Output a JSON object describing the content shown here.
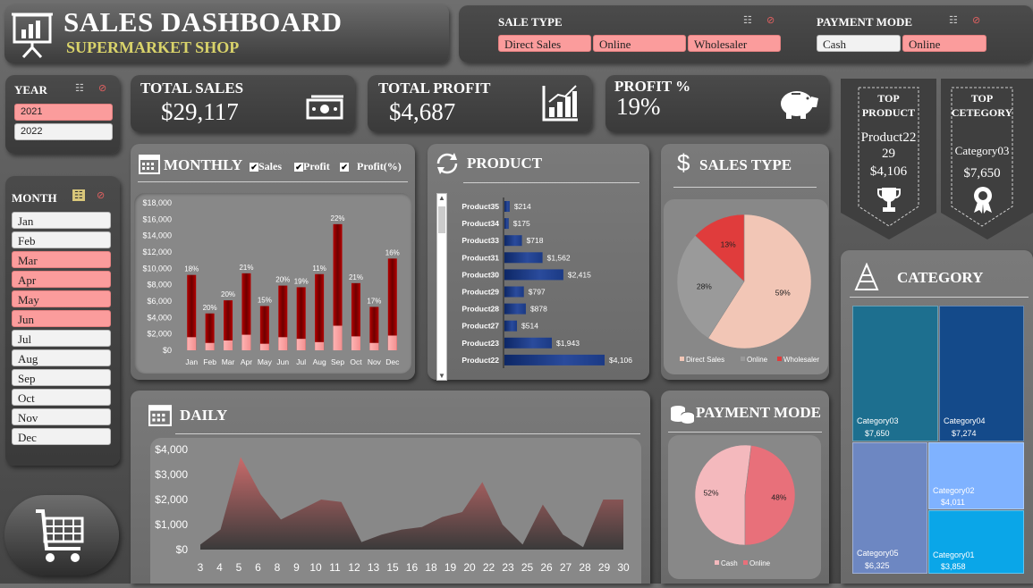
{
  "header": {
    "title": "SALES DASHBOARD",
    "subtitle": "SUPERMARKET SHOP"
  },
  "filters": {
    "sale_type": {
      "label": "SALE TYPE",
      "options": [
        {
          "label": "Direct Sales",
          "selected": true
        },
        {
          "label": "Online",
          "selected": true
        },
        {
          "label": "Wholesaler",
          "selected": true
        }
      ]
    },
    "payment_mode": {
      "label": "PAYMENT MODE",
      "options": [
        {
          "label": "Cash",
          "selected": false
        },
        {
          "label": "Online",
          "selected": true
        }
      ]
    },
    "year": {
      "label": "YEAR",
      "options": [
        {
          "label": "2021",
          "selected": true
        },
        {
          "label": "2022",
          "selected": false
        }
      ]
    },
    "month": {
      "label": "MONTH",
      "options": [
        {
          "label": "Jan",
          "selected": false
        },
        {
          "label": "Feb",
          "selected": false
        },
        {
          "label": "Mar",
          "selected": true
        },
        {
          "label": "Apr",
          "selected": true
        },
        {
          "label": "May",
          "selected": true
        },
        {
          "label": "Jun",
          "selected": true
        },
        {
          "label": "Jul",
          "selected": false
        },
        {
          "label": "Aug",
          "selected": false
        },
        {
          "label": "Sep",
          "selected": false
        },
        {
          "label": "Oct",
          "selected": false
        },
        {
          "label": "Nov",
          "selected": false
        },
        {
          "label": "Dec",
          "selected": false
        }
      ]
    }
  },
  "kpis": {
    "total_sales": {
      "label": "TOTAL SALES",
      "value": "$29,117"
    },
    "total_profit": {
      "label": "TOTAL PROFIT",
      "value": "$4,687"
    },
    "profit_pct": {
      "label": "PROFIT %",
      "value": "19%"
    }
  },
  "top_product": {
    "label": "TOP PRODUCT",
    "name": "Product22",
    "sub": "29",
    "value": "$4,106"
  },
  "top_category": {
    "label": "TOP CETEGORY",
    "name": "Category03",
    "value": "$7,650"
  },
  "monthly": {
    "title": "MONTHLY",
    "checks": [
      {
        "label": "Sales",
        "checked": true
      },
      {
        "label": "Profit",
        "checked": true
      },
      {
        "label": "Profit(%)",
        "checked": true
      }
    ]
  },
  "product": {
    "title": "PRODUCT"
  },
  "sales_type": {
    "title": "SALES TYPE"
  },
  "category": {
    "title": "CATEGORY"
  },
  "daily": {
    "title": "DAILY"
  },
  "payment": {
    "title": "PAYMENT MODE"
  },
  "colors": {
    "accent_red": "#c00000",
    "pink": "#fb9c9c",
    "navy": "#1f3c88",
    "subtitle": "#d9d36a"
  },
  "icons": {
    "logo": "presentation-chart-icon",
    "cart": "shopping-cart-icon",
    "money": "banknote-icon",
    "profit": "bar-chart-icon",
    "piggy": "piggy-bank-icon",
    "trophy": "trophy-icon",
    "medal": "medal-icon"
  },
  "chart_data": [
    {
      "type": "bar",
      "name": "monthly",
      "categories": [
        "Jan",
        "Feb",
        "Mar",
        "Apr",
        "May",
        "Jun",
        "Jul",
        "Aug",
        "Sep",
        "Oct",
        "Nov",
        "Dec"
      ],
      "series": [
        {
          "name": "Sales",
          "values": [
            9200,
            4500,
            6100,
            9400,
            5400,
            7900,
            7700,
            9300,
            15400,
            8200,
            5300,
            11200
          ]
        },
        {
          "name": "Profit",
          "values": [
            1600,
            900,
            1200,
            1900,
            800,
            1600,
            1400,
            1000,
            3000,
            1700,
            900,
            1800
          ]
        }
      ],
      "labels": [
        "18%",
        "20%",
        "20%",
        "21%",
        "15%",
        "20%",
        "19%",
        "11%",
        "22%",
        "21%",
        "17%",
        "16%"
      ],
      "yticks": [
        "$0",
        "$2,000",
        "$4,000",
        "$6,000",
        "$8,000",
        "$10,000",
        "$12,000",
        "$14,000",
        "$16,000",
        "$18,000"
      ],
      "ylim": [
        0,
        18000
      ]
    },
    {
      "type": "bar",
      "name": "product",
      "orientation": "horizontal",
      "categories": [
        "Product35",
        "Product34",
        "Product33",
        "Product31",
        "Product30",
        "Product29",
        "Product28",
        "Product27",
        "Product23",
        "Product22"
      ],
      "values": [
        214,
        175,
        718,
        1562,
        2415,
        797,
        878,
        514,
        1943,
        4106
      ],
      "labels": [
        "$214",
        "$175",
        "$718",
        "$1,562",
        "$2,415",
        "$797",
        "$878",
        "$514",
        "$1,943",
        "$4,106"
      ]
    },
    {
      "type": "pie",
      "name": "sales_type",
      "categories": [
        "Direct Sales",
        "Online",
        "Wholesaler"
      ],
      "values": [
        59,
        28,
        13
      ],
      "labels": [
        "59%",
        "28%",
        "13%"
      ],
      "colors": [
        "#f2c6b6",
        "#9a9a9a",
        "#e03c3c"
      ]
    },
    {
      "type": "area",
      "name": "daily",
      "x": [
        3,
        4,
        5,
        6,
        7,
        8,
        9,
        10,
        11,
        12,
        13,
        14,
        15,
        16,
        17,
        18,
        19,
        20,
        21,
        22,
        23,
        24,
        25,
        26,
        27,
        28,
        29,
        30
      ],
      "values": [
        200,
        800,
        3700,
        2200,
        1200,
        1600,
        2000,
        1900,
        300,
        600,
        800,
        900,
        1300,
        1500,
        2700,
        1000,
        200,
        1800,
        600,
        100,
        2000,
        2000
      ],
      "xticks": [
        "3",
        "4",
        "5",
        "6",
        "8",
        "9",
        "10",
        "11",
        "12",
        "13",
        "15",
        "16",
        "18",
        "19",
        "20",
        "22",
        "23",
        "25",
        "26",
        "27",
        "28",
        "29",
        "30"
      ],
      "yticks": [
        "$0",
        "$1,000",
        "$2,000",
        "$3,000",
        "$4,000"
      ],
      "ylim": [
        0,
        4000
      ]
    },
    {
      "type": "pie",
      "name": "payment_mode",
      "categories": [
        "Cash",
        "Online"
      ],
      "values": [
        52,
        48
      ],
      "labels": [
        "52%",
        "48%"
      ],
      "colors": [
        "#f4b9bd",
        "#e8707a"
      ]
    },
    {
      "type": "heatmap",
      "name": "category_treemap",
      "categories": [
        "Category03",
        "Category04",
        "Category05",
        "Category02",
        "Category01"
      ],
      "values": [
        7650,
        7274,
        6325,
        4011,
        3858
      ],
      "labels": [
        "$7,650",
        "$7,274",
        "$6,325",
        "$4,011",
        "$3,858"
      ],
      "colors": [
        "#1d6f8f",
        "#144a8a",
        "#6d87c2",
        "#7fb2ff",
        "#0aa6e8"
      ]
    }
  ]
}
